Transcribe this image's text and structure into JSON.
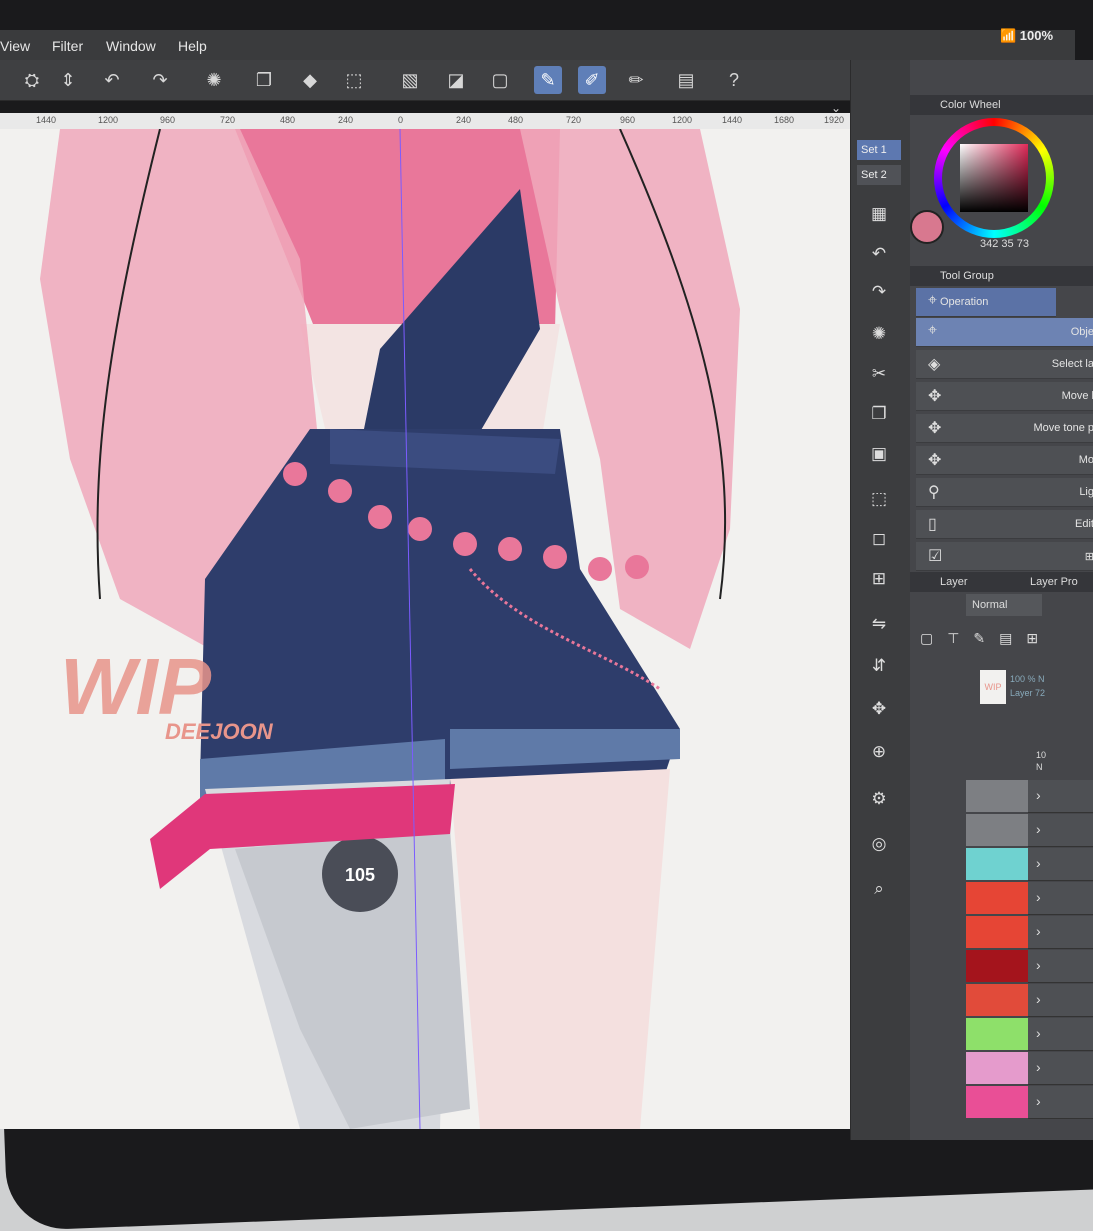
{
  "menu": {
    "items": [
      "View",
      "Filter",
      "Window",
      "Help"
    ]
  },
  "status": {
    "battery": "100%"
  },
  "ruler": {
    "ticks": [
      "1440",
      "1200",
      "960",
      "720",
      "480",
      "240",
      "0",
      "240",
      "480",
      "720",
      "960",
      "1200",
      "1440",
      "1680",
      "1920"
    ]
  },
  "sets": {
    "set1": "Set 1",
    "set2": "Set 2"
  },
  "color_panel": {
    "title": "Color Wheel",
    "rgb_r": "342",
    "rgb_g": "35",
    "rgb_b": "73",
    "main_color": "#d8788f"
  },
  "tool_group": {
    "title": "Tool Group",
    "operation": "Operation",
    "selected_tool": "Obje",
    "items": [
      "Select la",
      "Move l",
      "Move tone p",
      "Mo",
      "Lig",
      "Edit"
    ]
  },
  "layer_panel": {
    "title": "Layer",
    "tab2": "Layer Pro",
    "blend_mode": "Normal",
    "top_layer_opacity": "100 % N",
    "top_layer_name": "Layer 72",
    "row2_label": "10",
    "row2_sub": "N",
    "thumb_label": "WIP",
    "strip_colors": [
      "#7d7f83",
      "#7d7f83",
      "#6fd2d0",
      "#e64535",
      "#e64535",
      "#a4141c",
      "#e14b3a",
      "#8ee06a",
      "#e59bcc",
      "#e94f96"
    ]
  },
  "artwork": {
    "watermark": "WIP",
    "signature": "DEEJOON",
    "badge": "105",
    "colors": {
      "hair": "#f0a8bb",
      "top": "#e9779a",
      "denim": "#2b3a66",
      "bandana": "#e0377a",
      "prosthetic": "#c6c9cf"
    }
  }
}
